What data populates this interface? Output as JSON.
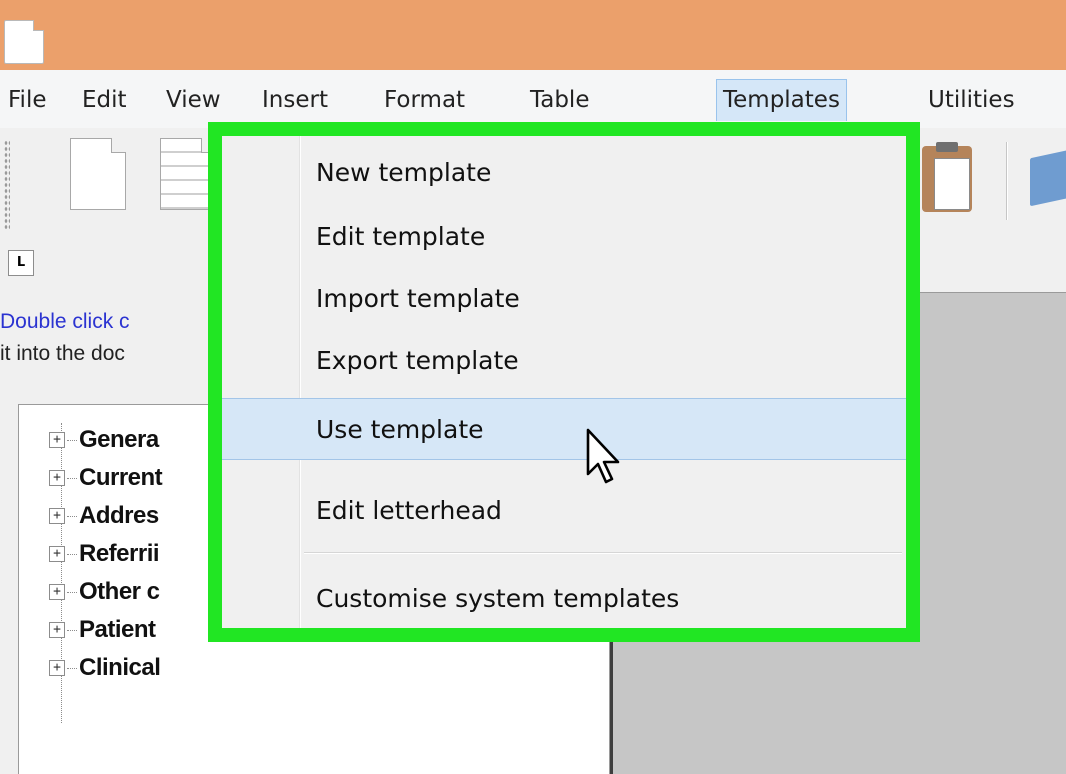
{
  "menubar": {
    "items": [
      "File",
      "Edit",
      "View",
      "Insert",
      "Format",
      "Table",
      "Templates",
      "Utilities"
    ],
    "active": "Templates"
  },
  "ruler_toggle": "L",
  "left_panel": {
    "hint_line1": "Double click c",
    "hint_line2": "it into the doc",
    "tree_items": [
      "Genera",
      "Current",
      "Addres",
      "Referrii",
      "Other c",
      "Patient",
      "Clinical"
    ],
    "expander_glyph": "+"
  },
  "templates_menu": {
    "items": [
      {
        "label": "New template"
      },
      {
        "label": "Edit template"
      },
      {
        "label": "Import template"
      },
      {
        "label": "Export template"
      },
      {
        "label": "Use template",
        "state": "hover"
      },
      {
        "label": "Edit letterhead"
      },
      {
        "label": "Customise system templates"
      }
    ]
  },
  "colors": {
    "titlebar": "#eba06b",
    "highlight_frame": "#21e623",
    "menu_hover": "#d6e7f7",
    "hint_text": "#2b33d1"
  },
  "icons": [
    "document-icon",
    "new-document-icon",
    "open-document-icon",
    "paste-icon",
    "folder-icon",
    "expand-plus-icon",
    "mouse-cursor-icon"
  ]
}
